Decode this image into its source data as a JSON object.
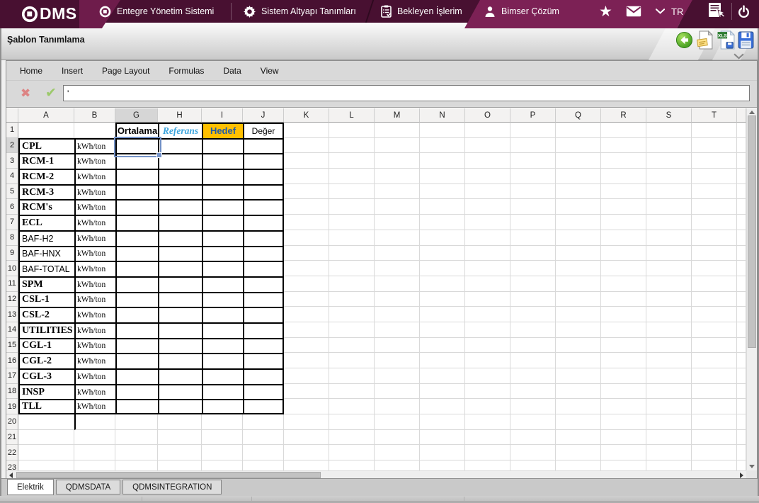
{
  "topbar": {
    "brand": "QDMS",
    "brand_display": "DMS",
    "menu": [
      {
        "id": "integrated-management-system",
        "label": "Entegre Yönetim Sistemi"
      },
      {
        "id": "system-infrastructure-definitions",
        "label": "Sistem Altyapı Tanımları"
      },
      {
        "id": "pending-tasks",
        "label": "Bekleyen İşlerim"
      },
      {
        "id": "bimser-solution",
        "label": "Bimser Çözüm"
      }
    ],
    "language": "TR",
    "colors": {
      "dark": "#481031",
      "light": "#7C2155"
    }
  },
  "titlebar": {
    "title": "Şablon Tanımlama",
    "xls_badge": "XLS"
  },
  "ribbon": {
    "tabs": [
      "Home",
      "Insert",
      "Page Layout",
      "Formulas",
      "Data",
      "View"
    ]
  },
  "formula_bar": {
    "value": "'"
  },
  "grid": {
    "columns": [
      "A",
      "B",
      "G",
      "H",
      "I",
      "J",
      "K",
      "L",
      "M",
      "N",
      "O",
      "P",
      "Q",
      "R",
      "S",
      "T"
    ],
    "visible_rows": 23,
    "selected_cell": "G2",
    "selected_column": "G",
    "selected_row": 2,
    "header_cells": [
      {
        "col": "G",
        "text": "Ortalama",
        "style": "h-bold"
      },
      {
        "col": "H",
        "text": "Referans",
        "style": "h-ref"
      },
      {
        "col": "I",
        "text": "Hedef",
        "style": "h-hedef"
      },
      {
        "col": "J",
        "text": "Değer",
        "style": "h-deger"
      }
    ],
    "data_rows": [
      {
        "row": 2,
        "a": "CPL",
        "b": "kWh/ton",
        "a_style": "a-serif"
      },
      {
        "row": 3,
        "a": "RCM-1",
        "b": "kWh/ton",
        "a_style": "a-serif"
      },
      {
        "row": 4,
        "a": "RCM-2",
        "b": "kWh/ton",
        "a_style": "a-serif"
      },
      {
        "row": 5,
        "a": "RCM-3",
        "b": "kWh/ton",
        "a_style": "a-serif"
      },
      {
        "row": 6,
        "a": "RCM's",
        "b": "kWh/ton",
        "a_style": "a-serif"
      },
      {
        "row": 7,
        "a": "ECL",
        "b": "kWh/ton",
        "a_style": "a-serif"
      },
      {
        "row": 8,
        "a": "BAF-H2",
        "b": "kWh/ton",
        "a_style": "a-sans"
      },
      {
        "row": 9,
        "a": "BAF-HNX",
        "b": "kWh/ton",
        "a_style": "a-sans"
      },
      {
        "row": 10,
        "a": "BAF-TOTAL",
        "b": "kWh/ton",
        "a_style": "a-sans"
      },
      {
        "row": 11,
        "a": "SPM",
        "b": "kWh/ton",
        "a_style": "a-serif"
      },
      {
        "row": 12,
        "a": "CSL-1",
        "b": "kWh/ton",
        "a_style": "a-serif"
      },
      {
        "row": 13,
        "a": "CSL-2",
        "b": "kWh/ton",
        "a_style": "a-serif"
      },
      {
        "row": 14,
        "a": "UTILITIES",
        "b": "kWh/ton",
        "a_style": "a-serif"
      },
      {
        "row": 15,
        "a": "CGL-1",
        "b": "kWh/ton",
        "a_style": "a-serif"
      },
      {
        "row": 16,
        "a": "CGL-2",
        "b": "kWh/ton",
        "a_style": "a-serif"
      },
      {
        "row": 17,
        "a": "CGL-3",
        "b": "kWh/ton",
        "a_style": "a-serif"
      },
      {
        "row": 18,
        "a": "INSP",
        "b": "kWh/ton",
        "a_style": "a-serif"
      },
      {
        "row": 19,
        "a": "TLL",
        "b": "kWh/ton",
        "a_style": "a-serif"
      }
    ],
    "colors": {
      "hedef_bg": "#FFC000",
      "hedef_text": "#1F5CA8",
      "referans_text": "#3BA4DD",
      "selection_border": "#7593C8"
    }
  },
  "sheet_tabs": [
    {
      "label": "Elektrik",
      "active": true
    },
    {
      "label": "QDMSDATA",
      "active": false
    },
    {
      "label": "QDMSINTEGRATION",
      "active": false
    }
  ]
}
